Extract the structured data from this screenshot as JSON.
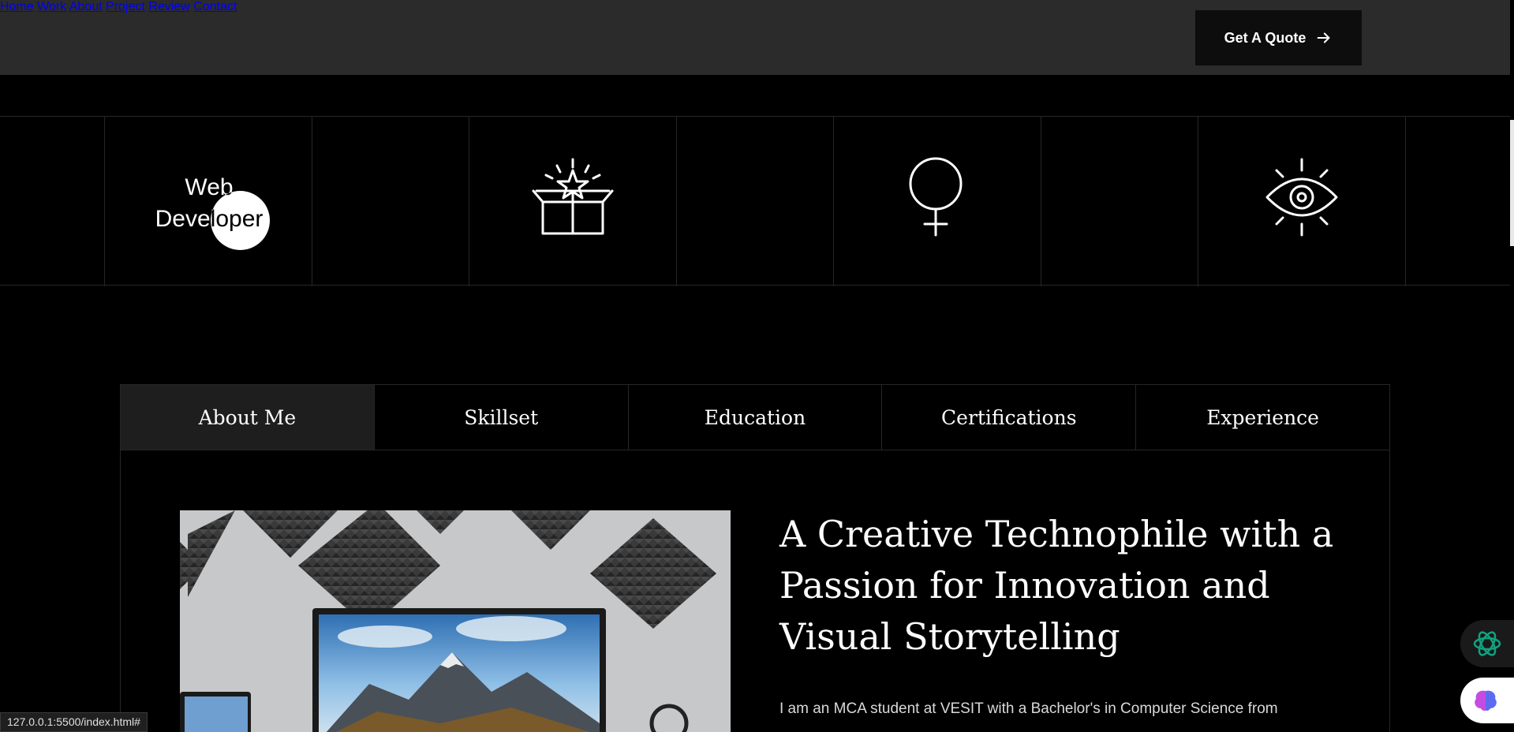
{
  "nav": {
    "items": [
      {
        "label": "Home"
      },
      {
        "label": "Work"
      },
      {
        "label": "About"
      },
      {
        "label": "Project"
      },
      {
        "label": "Review"
      },
      {
        "label": "Contact"
      }
    ],
    "cta_label": "Get A Quote",
    "cta_icon": "arrow-right-icon"
  },
  "strip": {
    "label_line1": "Web",
    "label_line2": "Developer",
    "icons": [
      "gift-box-icon",
      "female-symbol-icon",
      "eye-icon"
    ]
  },
  "tabs": [
    {
      "label": "About Me",
      "active": true
    },
    {
      "label": "Skillset",
      "active": false
    },
    {
      "label": "Education",
      "active": false
    },
    {
      "label": "Certifications",
      "active": false
    },
    {
      "label": "Experience",
      "active": false
    }
  ],
  "about": {
    "headline_line1": "A Creative Technophile with a",
    "headline_line2": "Passion for Innovation and",
    "headline_line3": "Visual Storytelling",
    "paragraph": "I am an MCA student at VESIT with a Bachelor's in Computer Science from"
  },
  "status_url": "127.0.0.1:5500/index.html#",
  "colors": {
    "header_bg": "#2b2b2b",
    "page_bg": "#000000",
    "active_tab_bg": "#1e1e1e",
    "cta_bg": "#0d0d0d"
  }
}
